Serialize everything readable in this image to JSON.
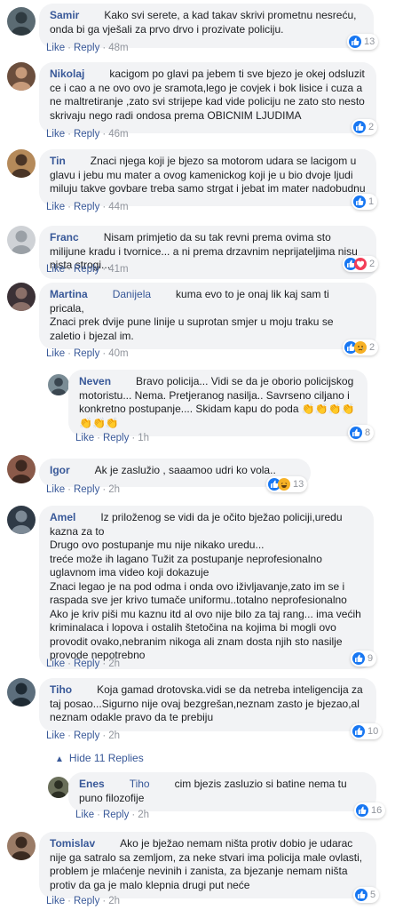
{
  "ui": {
    "like_label": "Like",
    "reply_label": "Reply",
    "dot": "·"
  },
  "colors": {
    "link": "#385898",
    "bubble_bg": "#f2f3f5",
    "meta": "#90949c",
    "like_blue": "#1877f2"
  },
  "comments": [
    {
      "name": "Samir",
      "tag": "",
      "text": "Kako svi serete, a kad takav skrivi prometnu nesreću, onda bi ga vješali za prvo drvo i prozivate policiju.",
      "time": "48m",
      "reactions": [
        "like"
      ],
      "count": "13"
    },
    {
      "name": "Nikolaj",
      "tag": "",
      "text": "kacigom po glavi pa jebem ti sve bjezo je okej odsluzit ce i cao a ne ovo ovo je sramota,lego je covjek i bok lisice i cuza a ne maltretiranje ,zato svi strijepe kad vide policiju ne zato sto nesto skrivaju nego radi ondosa prema OBICNIM LJUDIMA",
      "time": "46m",
      "reactions": [
        "like"
      ],
      "count": "2"
    },
    {
      "name": "Tin",
      "tag": "",
      "text": "Znaci njega koji je bjezo sa motorom udara se lacigom u glavu i jebu mu mater a ovog kamenickog koji je u bio dvoje ljudi miluju takve govbare treba samo strgat i jebat im mater nadobudnu",
      "time": "44m",
      "reactions": [
        "like"
      ],
      "count": "1"
    },
    {
      "name": "Franc",
      "tag": "",
      "text": "Nisam primjetio da su tak revni prema ovima sto milijune kradu i tvornice... a ni prema drzavnim neprijateljima nisu nista strogi...",
      "time": "41m",
      "reactions": [
        "like",
        "love"
      ],
      "count": "2"
    },
    {
      "name": "Martina",
      "tag": "Danijela",
      "text": "kuma evo to je onaj lik kaj sam ti pricala,\nZnaci prek dvije pune linije u suprotan smjer u moju traku se zaletio i bjezal im.",
      "time": "40m",
      "reactions": [
        "like",
        "sad"
      ],
      "count": "2"
    },
    {
      "name": "Neven",
      "tag": "",
      "text": "Bravo policija... Vidi se da je oborio policijskog motoristu... Nema. Pretjeranog nasilja.. Savrseno ciljano i konkretno postupanje.... Skidam kapu do poda 👏👏👏👏👏👏👏",
      "time": "1h",
      "reactions": [
        "like"
      ],
      "count": "8"
    },
    {
      "name": "Igor",
      "tag": "",
      "text": "Ak je zaslužio , saaamoo udri ko vola..",
      "time": "2h",
      "reactions": [
        "like",
        "haha"
      ],
      "count": "13"
    },
    {
      "name": "Amel",
      "tag": "",
      "text": "Iz priloženog se vidi da je očito bježao policiji,uredu kazna za to\nDrugo ovo postupanje mu nije nikako uredu...\ntreće može ih lagano Tužit za postupanje neprofesionalno uglavnom ima video koji dokazuje\nZnaci legao je na pod odma i onda ovo iživljavanje,zato im se i raspada sve jer krivo tumače uniformu..totalno neprofesionalno\nAko je kriv piši mu kaznu itd al ovo nije bilo za taj rang... ima većih kriminalaca i lopova i ostalih štetočina na kojima bi mogli ovo provodit ovako,nebranim nikoga ali znam dosta njih sto nasilje provode nepotrebno",
      "time": "2h",
      "reactions": [
        "like"
      ],
      "count": "9"
    },
    {
      "name": "Tiho",
      "tag": "",
      "text": "Koja gamad drotovska.vidi se da netreba inteligencija za taj posao...Sigurno nije ovaj bezgrešan,neznam zasto je bjezao,al neznam odakle pravo da te prebiju",
      "time": "2h",
      "reactions": [
        "like"
      ],
      "count": "10"
    },
    {
      "name": "Enes",
      "tag": "Tiho",
      "text": "cim bjezis zasluzio si batine nema tu puno filozofije",
      "time": "2h",
      "reactions": [
        "like"
      ],
      "count": "16"
    },
    {
      "name": "Tomislav",
      "tag": "",
      "text": "Ako je bježao nemam ništa protiv dobio je udarac nije ga satralo sa zemljom, za neke stvari ima policija male ovlasti, problem je mlaćenje nevinih i zanista, za bjezanje nemam ništa protiv da ga je malo klepnia drugi put neće",
      "time": "2h",
      "reactions": [
        "like"
      ],
      "count": "5"
    }
  ],
  "hide_replies": {
    "icon": "chevron-up-icon",
    "label": "Hide 11 Replies"
  }
}
